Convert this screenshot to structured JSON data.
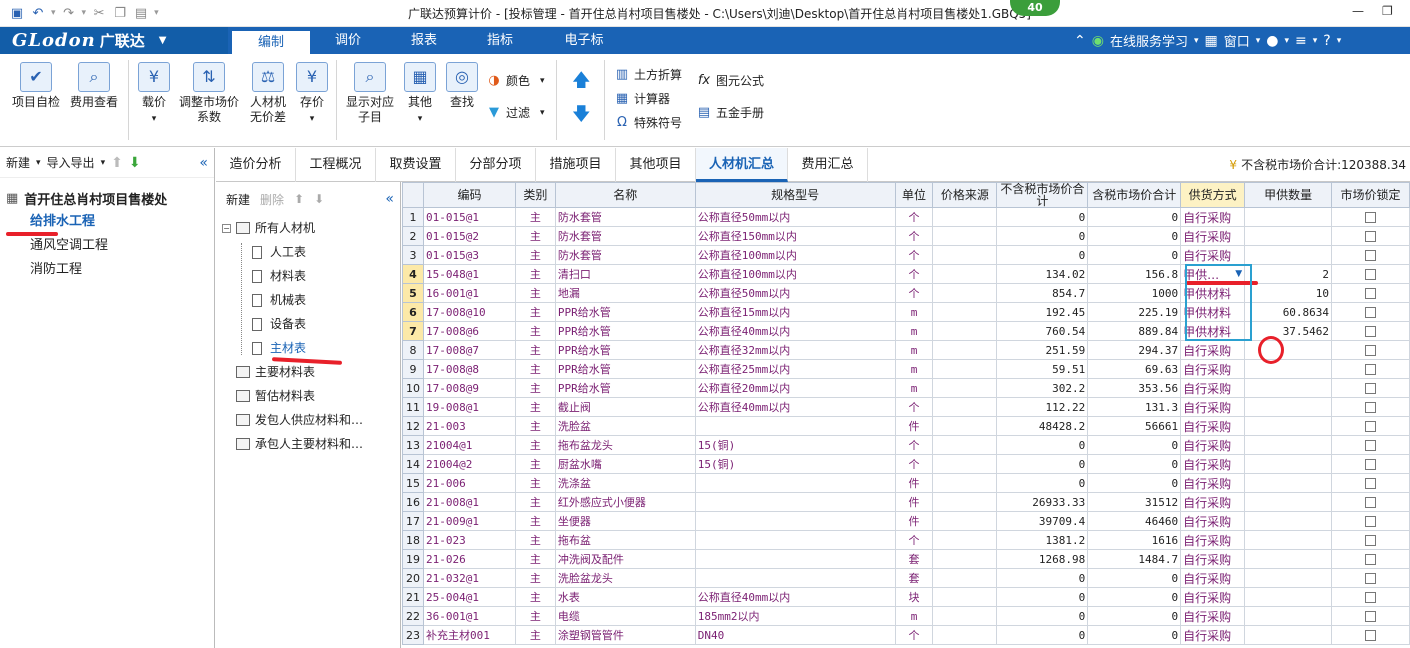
{
  "window": {
    "title": "广联达预算计价 - [投标管理 - 首开住总肖村项目售楼处 - C:\\Users\\刘迪\\Desktop\\首开住总肖村项目售楼处1.GBQ5]",
    "badge": "40"
  },
  "logo": {
    "brand": "GLodon",
    "brand_cn": "广联达"
  },
  "menu": {
    "tabs": [
      "编制",
      "调价",
      "报表",
      "指标",
      "电子标"
    ],
    "online": "在线服务学习",
    "window": "窗口"
  },
  "ribbon": {
    "big": [
      {
        "l1": "项目自检",
        "l2": ""
      },
      {
        "l1": "费用查看",
        "l2": ""
      },
      {
        "l1": "载价",
        "l2": ""
      },
      {
        "l1": "调整市场价",
        "l2": "系数"
      },
      {
        "l1": "人材机",
        "l2": "无价差"
      },
      {
        "l1": "存价",
        "l2": ""
      },
      {
        "l1": "显示对应",
        "l2": "子目"
      },
      {
        "l1": "其他",
        "l2": ""
      },
      {
        "l1": "查找",
        "l2": ""
      }
    ],
    "small": {
      "color": "颜色",
      "filter": "过滤",
      "earth": "土方折算",
      "calc": "计算器",
      "special": "特殊符号",
      "formula": "图元公式",
      "hardware": "五金手册"
    }
  },
  "left": {
    "toolbar": {
      "new": "新建",
      "import": "导入导出"
    },
    "root": "首开住总肖村项目售楼处",
    "items": [
      "给排水工程",
      "通风空调工程",
      "消防工程"
    ]
  },
  "mid": {
    "toolbar": {
      "new": "新建",
      "delete": "删除"
    },
    "tree": [
      "所有人材机",
      "人工表",
      "材料表",
      "机械表",
      "设备表",
      "主材表",
      "主要材料表",
      "暂估材料表",
      "发包人供应材料和…",
      "承包人主要材料和…"
    ]
  },
  "tabs": [
    "造价分析",
    "工程概况",
    "取费设置",
    "分部分项",
    "措施项目",
    "其他项目",
    "人材机汇总",
    "费用汇总"
  ],
  "taxinfo": "不含税市场价合计:120388.34",
  "grid": {
    "headers": [
      "",
      "编码",
      "类别",
      "名称",
      "规格型号",
      "单位",
      "价格来源",
      "不含税市场价合计",
      "含税市场价合计",
      "供货方式",
      "甲供数量",
      "市场价锁定"
    ],
    "rows": [
      [
        "1",
        "01-015@1",
        "主",
        "防水套管",
        "公称直径50mm以内",
        "个",
        "",
        "0",
        "0",
        "自行采购",
        ""
      ],
      [
        "2",
        "01-015@2",
        "主",
        "防水套管",
        "公称直径150mm以内",
        "个",
        "",
        "0",
        "0",
        "自行采购",
        ""
      ],
      [
        "3",
        "01-015@3",
        "主",
        "防水套管",
        "公称直径100mm以内",
        "个",
        "",
        "0",
        "0",
        "自行采购",
        ""
      ],
      [
        "4",
        "15-048@1",
        "主",
        "清扫口",
        "公称直径100mm以内",
        "个",
        "",
        "134.02",
        "156.8",
        "甲供…",
        "2"
      ],
      [
        "5",
        "16-001@1",
        "主",
        "地漏",
        "公称直径50mm以内",
        "个",
        "",
        "854.7",
        "1000",
        "甲供材料",
        "10"
      ],
      [
        "6",
        "17-008@10",
        "主",
        "PPR给水管",
        "公称直径15mm以内",
        "m",
        "",
        "192.45",
        "225.19",
        "甲供材料",
        "60.8634"
      ],
      [
        "7",
        "17-008@6",
        "主",
        "PPR给水管",
        "公称直径40mm以内",
        "m",
        "",
        "760.54",
        "889.84",
        "甲供材料",
        "37.5462"
      ],
      [
        "8",
        "17-008@7",
        "主",
        "PPR给水管",
        "公称直径32mm以内",
        "m",
        "",
        "251.59",
        "294.37",
        "自行采购",
        ""
      ],
      [
        "9",
        "17-008@8",
        "主",
        "PPR给水管",
        "公称直径25mm以内",
        "m",
        "",
        "59.51",
        "69.63",
        "自行采购",
        ""
      ],
      [
        "10",
        "17-008@9",
        "主",
        "PPR给水管",
        "公称直径20mm以内",
        "m",
        "",
        "302.2",
        "353.56",
        "自行采购",
        ""
      ],
      [
        "11",
        "19-008@1",
        "主",
        "截止阀",
        "公称直径40mm以内",
        "个",
        "",
        "112.22",
        "131.3",
        "自行采购",
        ""
      ],
      [
        "12",
        "21-003",
        "主",
        "洗脸盆",
        "",
        "件",
        "",
        "48428.2",
        "56661",
        "自行采购",
        ""
      ],
      [
        "13",
        "21004@1",
        "主",
        "拖布盆龙头",
        "15(铜)",
        "个",
        "",
        "0",
        "0",
        "自行采购",
        ""
      ],
      [
        "14",
        "21004@2",
        "主",
        "厨盆水嘴",
        "15(铜)",
        "个",
        "",
        "0",
        "0",
        "自行采购",
        ""
      ],
      [
        "15",
        "21-006",
        "主",
        "洗涤盆",
        "",
        "件",
        "",
        "0",
        "0",
        "自行采购",
        ""
      ],
      [
        "16",
        "21-008@1",
        "主",
        "红外感应式小便器",
        "",
        "件",
        "",
        "26933.33",
        "31512",
        "自行采购",
        ""
      ],
      [
        "17",
        "21-009@1",
        "主",
        "坐便器",
        "",
        "件",
        "",
        "39709.4",
        "46460",
        "自行采购",
        ""
      ],
      [
        "18",
        "21-023",
        "主",
        "拖布盆",
        "",
        "个",
        "",
        "1381.2",
        "1616",
        "自行采购",
        ""
      ],
      [
        "19",
        "21-026",
        "主",
        "冲洗阀及配件",
        "",
        "套",
        "",
        "1268.98",
        "1484.7",
        "自行采购",
        ""
      ],
      [
        "20",
        "21-032@1",
        "主",
        "洗脸盆龙头",
        "",
        "套",
        "",
        "0",
        "0",
        "自行采购",
        ""
      ],
      [
        "21",
        "25-004@1",
        "主",
        "水表",
        "公称直径40mm以内",
        "块",
        "",
        "0",
        "0",
        "自行采购",
        ""
      ],
      [
        "22",
        "36-001@1",
        "主",
        "电缆",
        "185mm2以内",
        "m",
        "",
        "0",
        "0",
        "自行采购",
        ""
      ],
      [
        "23",
        "补充主材001",
        "主",
        "涂塑钢管管件",
        "DN40",
        "个",
        "",
        "0",
        "0",
        "自行采购",
        ""
      ]
    ]
  }
}
